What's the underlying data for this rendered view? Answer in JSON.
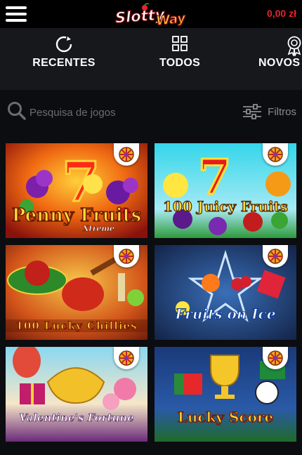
{
  "header": {
    "logo_text": "SlottyWay",
    "balance": "0,00 zł"
  },
  "nav": {
    "tabs": [
      {
        "label": "RECENTES",
        "icon": "refresh-icon"
      },
      {
        "label": "TODOS",
        "icon": "grid-icon"
      },
      {
        "label": "NOVOS JOGOS",
        "icon": "award-icon"
      }
    ]
  },
  "search": {
    "placeholder": "Pesquisa de jogos",
    "filters_label": "Filtros"
  },
  "games": [
    {
      "title": "Penny Fruits",
      "subtitle": "Xtreme",
      "badge": "wheel-badge-icon"
    },
    {
      "title": "100 Juicy Fruits",
      "badge": "wheel-badge-icon"
    },
    {
      "title": "100 Lucky Chillies",
      "badge": "wheel-badge-icon"
    },
    {
      "title": "Fruits on Ice",
      "badge": "wheel-badge-icon"
    },
    {
      "title": "Valentine's Fortune",
      "badge": "wheel-badge-icon"
    },
    {
      "title": "Lucky Score",
      "badge": "wheel-badge-icon"
    }
  ],
  "colors": {
    "accent": "#e8232a",
    "background": "#0c0d10",
    "nav_bg": "#17181c"
  }
}
